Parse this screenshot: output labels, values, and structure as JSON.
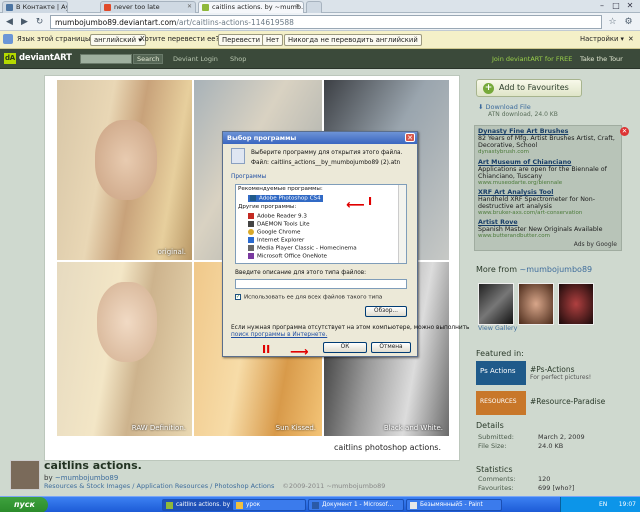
{
  "browser": {
    "tabs": [
      {
        "label": "В Контакте | Аудио",
        "icon_color": "#4c75a3"
      },
      {
        "label": "never too late",
        "icon_color": "#e04a2a"
      },
      {
        "label": "caitlins actions. by ~mumb…",
        "icon_color": "#8fb83a"
      },
      {
        "label": "",
        "icon_color": "#cccccc"
      }
    ],
    "url_host": "mumbojumbo89.deviantart.com",
    "url_path": "/art/caitlins-actions-114619588",
    "window_controls": {
      "minimize": "–",
      "maximize": "□",
      "close": "✕"
    },
    "nav_icons": {
      "back": "back-arrow-icon",
      "forward": "forward-arrow-icon",
      "reload": "reload-icon",
      "star": "star-icon",
      "wrench": "wrench-icon"
    }
  },
  "translate_bar": {
    "lang_label": "Язык этой страницы",
    "lang_value": "английский",
    "question": "Хотите перевести ее?",
    "translate_button": "Перевести",
    "no_button": "Нет",
    "never_button": "Никогда не переводить английский",
    "settings": "Настройки"
  },
  "da_header": {
    "logo": "deviantART",
    "search_button": "Search",
    "deviant_login": "Deviant Login",
    "shop": "Shop",
    "join": "Join deviantART for FREE",
    "tour": "Take the Tour"
  },
  "artwork": {
    "captions": {
      "original": "original.",
      "raw": "RAW Definition.",
      "sun": "Sun Kissed.",
      "bw": "Black and White."
    },
    "signature": "caitlins photoshop actions."
  },
  "dialog": {
    "title": "Выбор программы",
    "close": "✕",
    "prompt": "Выберите программу для открытия этого файла.",
    "file_label": "Файл:",
    "file_name": "caitlins_actions__by_mumbojumbo89 (2).atn",
    "programs_label": "Программы",
    "recommended": "Рекомендуемые программы:",
    "other": "Другие программы:",
    "programs": [
      "Adobe Photoshop CS4",
      "Adobe Reader 9.3",
      "DAEMON Tools Lite",
      "Google Chrome",
      "Internet Explorer",
      "Media Player Classic - Homecinema",
      "Microsoft Office OneNote"
    ],
    "desc_label": "Введите описание для этого типа файлов:",
    "always_use": "Использовать ее для всех файлов такого типа",
    "browse": "Обзор...",
    "help_text": "Если нужная программа отсутствует на этом компьютере, можно выполнить",
    "help_link": "поиск программы в Интернете.",
    "ok": "ОК",
    "cancel": "Отмена",
    "marker_1": "I",
    "marker_2": "II"
  },
  "sidebar": {
    "favourites": "Add to Favourites",
    "download_label": "Download File",
    "download_info": "ATN download, 24.0 KB",
    "ads": [
      {
        "title": "Dynasty Fine Art Brushes",
        "text": "82 Years of Mfg. Artist Brushes Artist, Craft, Decorative, School",
        "url": "dynastybrush.com"
      },
      {
        "title": "Art Museum of Chianciano",
        "text": "Applications are open for the Biennale of Chianciano, Tuscany",
        "url": "www.museodarte.org/biennale"
      },
      {
        "title": "XRF Art Analysis Tool",
        "text": "Handheld XRF Spectrometer for Non-destructive art analysis",
        "url": "www.bruker-axs.com/art-conservation"
      },
      {
        "title": "Artist Rove",
        "text": "Spanish Master New Originals Available",
        "url": "www.butterandbutter.com"
      }
    ],
    "ads_by": "Ads by Google",
    "more_from_label": "More from",
    "more_from_user": "~mumbojumbo89",
    "view_gallery": "View Gallery",
    "featured_in": "Featured in:",
    "features": [
      {
        "name": "#Ps-Actions",
        "sub": "For perfect pictures!",
        "badge": "Ps Actions",
        "color": "#1f5a8a"
      },
      {
        "name": "#Resource-Paradise",
        "sub": "",
        "badge": "RESOURCES",
        "color": "#c8772a"
      }
    ],
    "details_label": "Details",
    "details": [
      {
        "k": "Submitted:",
        "v": "March 2, 2009"
      },
      {
        "k": "File Size:",
        "v": "24.0 KB"
      }
    ],
    "stats_label": "Statistics",
    "stats": [
      {
        "k": "Comments:",
        "v": "120"
      },
      {
        "k": "Favourites:",
        "v": "699 [who?]"
      }
    ]
  },
  "deviation": {
    "title": "caitlins actions.",
    "by": "by",
    "author": "~mumbojumbo89",
    "category": "Resources & Stock Images / Application Resources / Photoshop Actions",
    "copyright": "©2009-2011 ~mumbojumbo89"
  },
  "taskbar": {
    "start": "пуск",
    "items": [
      {
        "label": "caitlins actions. by ~m…",
        "color": "#8fb83a"
      },
      {
        "label": "урок",
        "color": "#f0c040"
      },
      {
        "label": "Документ 1 - Microsof…",
        "color": "#2a5aa8"
      },
      {
        "label": "Безымянный5 - Paint",
        "color": "#e8e8e8"
      }
    ],
    "lang": "EN",
    "clock": "19:07"
  }
}
